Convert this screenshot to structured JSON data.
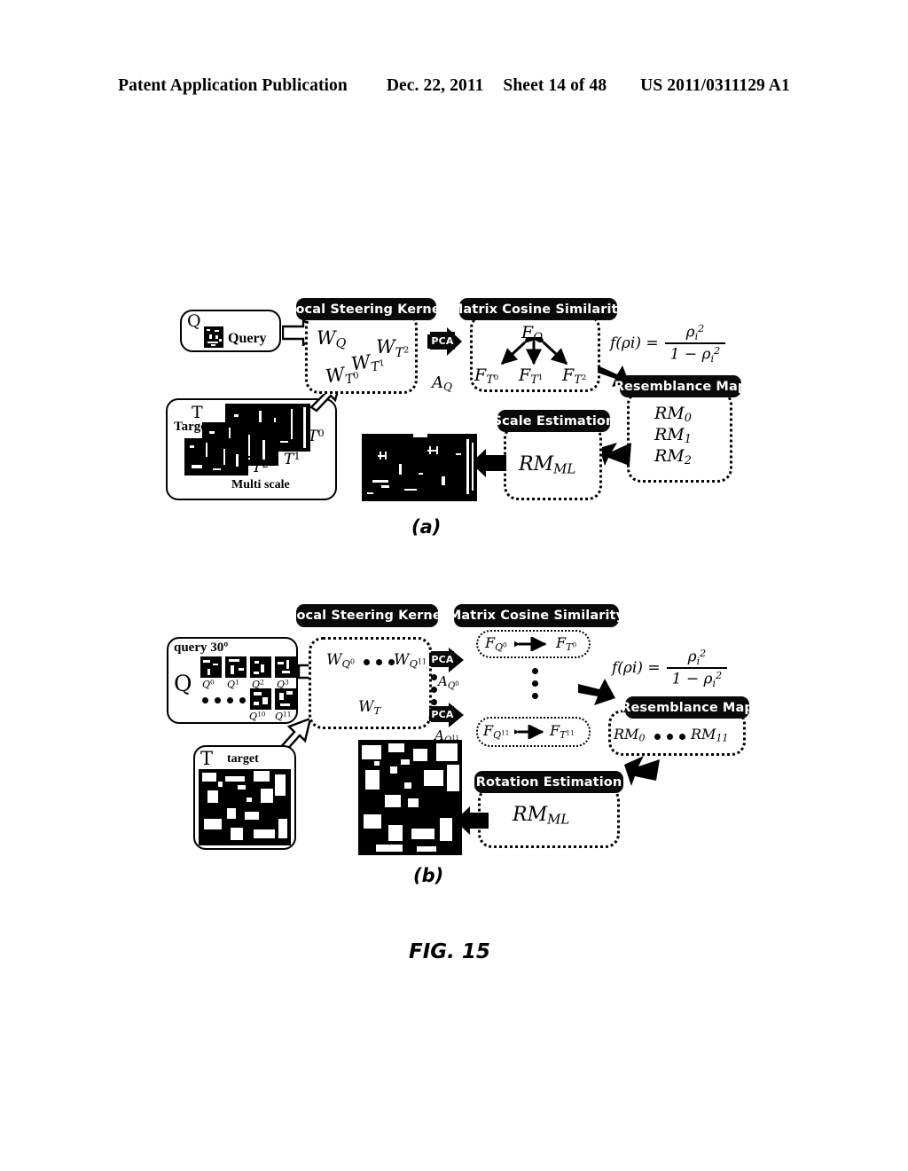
{
  "header": {
    "publication": "Patent Application Publication",
    "date": "Dec. 22, 2011",
    "sheet": "Sheet 14 of 48",
    "number": "US 2011/0311129 A1"
  },
  "figure": {
    "caption": "FIG. 15",
    "panels": [
      {
        "id": "a",
        "caption": "(a)",
        "query_box": {
          "symbol": "Q",
          "label": "Query"
        },
        "target_box": {
          "symbol": "T",
          "label": "Target",
          "footer": "Multi scale",
          "scale_labels": [
            "T0",
            "T1",
            "T2"
          ]
        },
        "lsk_box": {
          "banner": "Local Steering Kernel",
          "weights": [
            "WQ",
            "WT0",
            "WT1",
            "WT2"
          ]
        },
        "pca": {
          "label": "PCA",
          "output": "AQ"
        },
        "mcs_box": {
          "banner": "Matrix Cosine Similarity",
          "query_feature": "FQ",
          "target_features": [
            "FT0",
            "FT1",
            "FT2"
          ]
        },
        "formula": {
          "lhs": "f(ρi) =",
          "numerator": "ρi2",
          "denominator": "1 − ρi2"
        },
        "resemblance_box": {
          "banner": "Resemblance Map",
          "maps": [
            "RM0",
            "RM1",
            "RM2"
          ]
        },
        "estimation_box": {
          "banner": "Scale Estimation",
          "output": "RMML"
        }
      },
      {
        "id": "b",
        "caption": "(b)",
        "query_box": {
          "symbol": "Q",
          "label": "query  30º",
          "patch_labels": [
            "Q0",
            "Q1",
            "Q2",
            "Q3",
            "Q10",
            "Q11"
          ]
        },
        "target_box": {
          "symbol": "T",
          "label": "target"
        },
        "lsk_box": {
          "banner": "Local Steering Kernel",
          "weights": [
            "WQ0",
            "WQ11",
            "WT"
          ]
        },
        "pca": {
          "label": "PCA",
          "outputs": [
            "AQ0",
            "AQ11"
          ]
        },
        "mcs_box": {
          "banner": "Matrix Cosine Similarity",
          "pairs": [
            {
              "left": "FQ0",
              "right": "FT0"
            },
            {
              "left": "FQ11",
              "right": "FT11"
            }
          ]
        },
        "formula": {
          "lhs": "f(ρi) =",
          "numerator": "ρi2",
          "denominator": "1 − ρi2"
        },
        "resemblance_box": {
          "banner": "Resemblance Map",
          "maps": [
            "RM0",
            "RM11"
          ]
        },
        "estimation_box": {
          "banner": "Rotation Estimation",
          "output": "RMML"
        }
      }
    ]
  }
}
